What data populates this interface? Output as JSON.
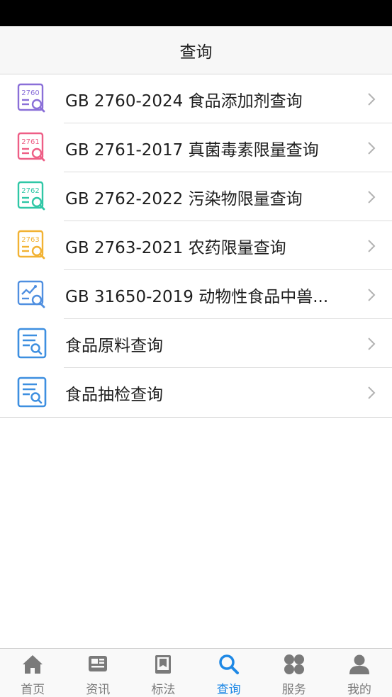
{
  "header": {
    "title": "查询"
  },
  "list": [
    {
      "label": "GB 2760-2024 食品添加剂查询",
      "icon": "doc-2760-search-icon",
      "icon_text": "2760",
      "color": "#8a6fd8"
    },
    {
      "label": "GB 2761-2017 真菌毒素限量查询",
      "icon": "doc-2761-search-icon",
      "icon_text": "2761",
      "color": "#ee5e86"
    },
    {
      "label": "GB 2762-2022 污染物限量查询",
      "icon": "doc-2762-search-icon",
      "icon_text": "2762",
      "color": "#2fc7a6"
    },
    {
      "label": "GB 2763-2021 农药限量查询",
      "icon": "doc-2763-search-icon",
      "icon_text": "2763",
      "color": "#f2b233"
    },
    {
      "label": "GB 31650-2019 动物性食品中兽...",
      "icon": "chart-search-icon",
      "color": "#4f8fe0"
    },
    {
      "label": "食品原料查询",
      "icon": "doc-search-icon",
      "color": "#3d8fe0"
    },
    {
      "label": "食品抽检查询",
      "icon": "doc-search-icon",
      "color": "#3d8fe0"
    }
  ],
  "tabs": [
    {
      "label": "首页",
      "icon": "home-icon",
      "active": false
    },
    {
      "label": "资讯",
      "icon": "news-icon",
      "active": false
    },
    {
      "label": "标法",
      "icon": "standard-book-icon",
      "active": false
    },
    {
      "label": "查询",
      "icon": "search-icon",
      "active": true
    },
    {
      "label": "服务",
      "icon": "clover-icon",
      "active": false
    },
    {
      "label": "我的",
      "icon": "user-icon",
      "active": false
    }
  ],
  "colors": {
    "tab_active": "#1e88e5",
    "tab_inactive": "#7a7a7a",
    "chevron": "#b3b3b3"
  }
}
